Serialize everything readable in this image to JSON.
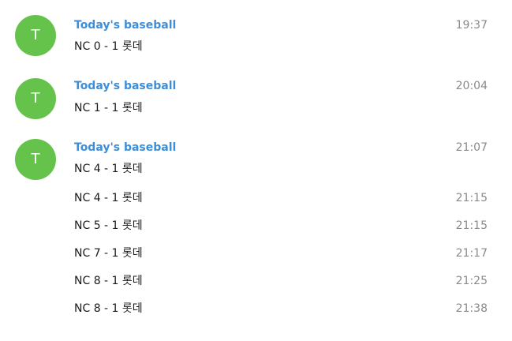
{
  "colors": {
    "avatar_bg": "#65c34b",
    "sender": "#3d8ed9"
  },
  "groups": [
    {
      "avatar": "T",
      "sender": "Today's baseball",
      "messages": [
        {
          "text": "NC 0 - 1 롯데",
          "time": "19:37"
        }
      ]
    },
    {
      "avatar": "T",
      "sender": "Today's baseball",
      "messages": [
        {
          "text": "NC 1 - 1 롯데",
          "time": "20:04"
        }
      ]
    },
    {
      "avatar": "T",
      "sender": "Today's baseball",
      "messages": [
        {
          "text": "NC 4 - 1 롯데",
          "time": "21:07"
        },
        {
          "text": "NC 4 - 1 롯데",
          "time": "21:15"
        },
        {
          "text": "NC 5 - 1 롯데",
          "time": "21:15"
        },
        {
          "text": "NC 7 - 1 롯데",
          "time": "21:17"
        },
        {
          "text": "NC 8 - 1 롯데",
          "time": "21:25"
        },
        {
          "text": "NC 8 - 1 롯데",
          "time": "21:38"
        }
      ]
    }
  ]
}
